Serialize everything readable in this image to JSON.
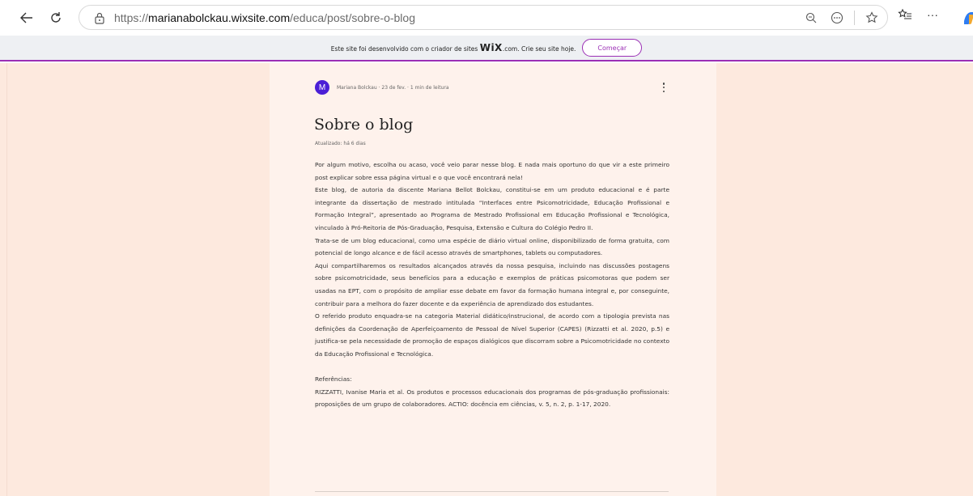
{
  "browser": {
    "url_prefix": "https://",
    "url_host": "marianabolckau.wixsite.com",
    "url_path": "/educa/post/sobre-o-blog",
    "more_label": "···"
  },
  "wix_banner": {
    "text_before": "Este site foi desenvolvido com o criador de sites ",
    "logo": "WiX",
    "text_after": ".com. Crie seu site hoje.",
    "cta": "Começar",
    "accent_color": "#9b2fb5"
  },
  "post": {
    "avatar_initial": "M",
    "meta": "Mariana Bolckau · 23 de fev. · 1 min de leitura",
    "title": "Sobre o blog",
    "updated": "Atualizado: há 6 dias",
    "paragraphs": [
      "Por algum motivo, escolha ou acaso, você veio parar nesse blog. E nada mais oportuno do que vir a este primeiro post explicar sobre essa página virtual e o que você encontrará nela!",
      "Este blog, de autoria da discente Mariana Bellot Bolckau, constitui-se em um produto educacional e é parte integrante da dissertação de mestrado intitulada “Interfaces entre Psicomotricidade, Educação Profissional e Formação Integral”, apresentado ao Programa de Mestrado Profissional em Educação Profissional e Tecnológica, vinculado à Pró-Reitoria de Pós-Graduação, Pesquisa, Extensão e Cultura do Colégio Pedro II.",
      "Trata-se de um blog educacional, como uma espécie de diário virtual online, disponibilizado de forma gratuita, com potencial de longo alcance e de fácil acesso através de smartphones, tablets ou computadores.",
      "Aqui compartilharemos os resultados alcançados através da nossa pesquisa, incluindo nas discussões postagens sobre psicomotricidade, seus benefícios para a educação e exemplos de práticas psicomotoras que podem ser usadas na EPT, com o propósito de ampliar esse debate em favor da formação humana integral e, por conseguinte, contribuir para a melhora do fazer docente e da experiência de aprendizado dos estudantes.",
      "O referido produto enquadra-se na categoria Material didático/instrucional, de acordo com a tipologia prevista nas definições da Coordenação de Aperfeiçoamento de Pessoal de Nível Superior (CAPES) (Rizzatti et al. 2020, p.5) e justifica-se pela necessidade de promoção de espaços dialógicos que discorram sobre a Psicomotricidade no contexto da Educação Profissional e Tecnológica."
    ],
    "references_label": "Referências:",
    "reference": "RIZZATTI, Ivanise Maria et al. Os produtos e processos educacionais dos programas de pós-graduação profissionais: proposições de um grupo de colaboradores. ACTIO: docência em ciências, v. 5, n. 2, p. 1-17, 2020."
  }
}
